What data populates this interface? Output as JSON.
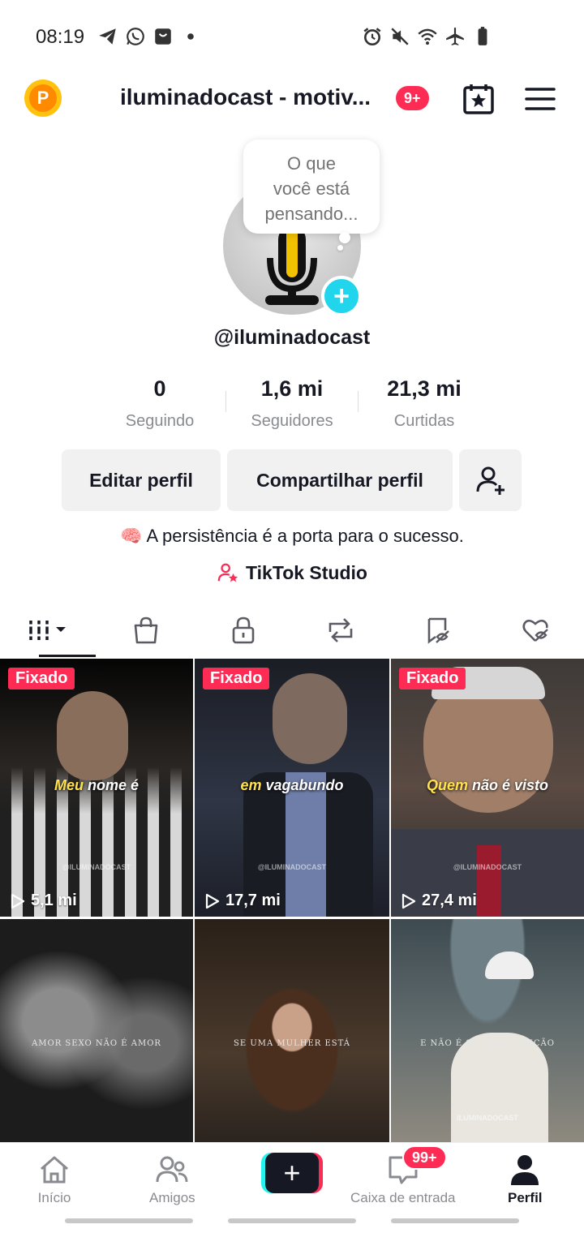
{
  "status_bar": {
    "time": "08:19",
    "left_icons": [
      "telegram-icon",
      "whatsapp-icon",
      "shop-icon",
      "dot-icon"
    ],
    "right_icons": [
      "alarm-icon",
      "mute-icon",
      "wifi-icon",
      "airplane-icon",
      "battery-icon"
    ]
  },
  "header": {
    "coin_label": "P",
    "title": "iluminadocast - motiv...",
    "notification_count": "9+"
  },
  "profile": {
    "thought_bubble": [
      "O que",
      "você está",
      "pensando..."
    ],
    "add_icon": "+",
    "username": "@iluminadocast",
    "stats": [
      {
        "value": "0",
        "label": "Seguindo"
      },
      {
        "value": "1,6 mi",
        "label": "Seguidores"
      },
      {
        "value": "21,3 mi",
        "label": "Curtidas"
      }
    ],
    "buttons": {
      "edit": "Editar perfil",
      "share": "Compartilhar perfil"
    },
    "bio_emoji": "🧠",
    "bio": "A persistência é a porta para o sucesso.",
    "studio_link": "TikTok Studio"
  },
  "tabs": [
    "videos-grid-icon",
    "shop-bag-icon",
    "lock-icon",
    "repost-icon",
    "favorites-icon",
    "liked-icon"
  ],
  "videos": [
    {
      "pinned": "Fixado",
      "caption_hl": "Meu",
      "caption": " nome é",
      "watermark": "@ILUMINADOCAST",
      "views": "5,1 mi",
      "bg": "#3a3434"
    },
    {
      "pinned": "Fixado",
      "caption_hl": "em",
      "caption": " vagabundo",
      "watermark": "@ILUMINADOCAST",
      "views": "17,7 mi",
      "bg": "#2b2f3c"
    },
    {
      "pinned": "Fixado",
      "caption_hl": "Quem",
      "caption": " não é visto",
      "watermark": "@ILUMINADOCAST",
      "views": "27,4 mi",
      "bg": "#4a3e3a"
    },
    {
      "caption_small": "AMOR SEXO NÃO É AMOR",
      "bg": "#2a2a2a"
    },
    {
      "caption_small": "SE UMA MULHER ESTÁ",
      "bg": "#3b2e24"
    },
    {
      "caption_small": "E NÃO É SÓ UMA ELEIÇÃO",
      "watermark": "ILUMINADOCAST",
      "bg": "#4b5256"
    }
  ],
  "bottom_nav": {
    "items": [
      {
        "label": "Início",
        "icon": "home-icon"
      },
      {
        "label": "Amigos",
        "icon": "friends-icon"
      },
      {
        "label": "Caixa de entrada",
        "icon": "inbox-icon"
      },
      {
        "label": "Perfil",
        "icon": "profile-icon"
      }
    ],
    "create_label": "+",
    "inbox_badge": "99+"
  }
}
